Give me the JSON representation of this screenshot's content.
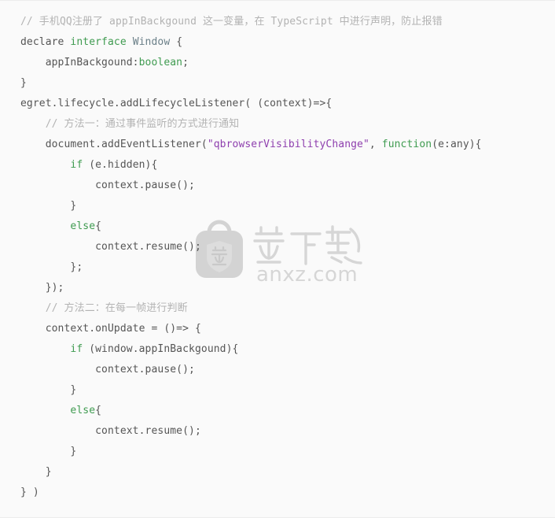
{
  "document": {
    "type": "code-snippet",
    "language": "TypeScript",
    "background_color": "#fafafa",
    "border_color": "#ececec",
    "colors": {
      "plain": "#555555",
      "comment": "#b3b3b3",
      "keyword": "#3f9b50",
      "type": "#6a7f88",
      "string": "#8e3fae",
      "watermark": "#d6d6d6"
    }
  },
  "code": {
    "lines": [
      {
        "index": 1,
        "text": "// 手机QQ注册了 appInBackgound 这一变量，在 TypeScript 中进行声明，防止报错",
        "tokens": [
          {
            "t": "// 手机QQ注册了 appInBackgound 这一变量，在 TypeScript 中进行声明，防止报错",
            "c": "comment"
          }
        ]
      },
      {
        "index": 2,
        "text": "declare interface Window {",
        "tokens": [
          {
            "t": "declare ",
            "c": "plain"
          },
          {
            "t": "interface",
            "c": "keyword"
          },
          {
            "t": " ",
            "c": "plain"
          },
          {
            "t": "Window",
            "c": "type"
          },
          {
            "t": " {",
            "c": "plain"
          }
        ]
      },
      {
        "index": 3,
        "text": "    appInBackgound:boolean;",
        "tokens": [
          {
            "t": "    appInBackgound:",
            "c": "plain"
          },
          {
            "t": "boolean",
            "c": "keyword"
          },
          {
            "t": ";",
            "c": "plain"
          }
        ]
      },
      {
        "index": 4,
        "text": "}",
        "tokens": [
          {
            "t": "}",
            "c": "plain"
          }
        ]
      },
      {
        "index": 5,
        "text": "egret.lifecycle.addLifecycleListener( (context)=>{",
        "tokens": [
          {
            "t": "egret.lifecycle.addLifecycleListener( (context)=>{",
            "c": "plain"
          }
        ]
      },
      {
        "index": 6,
        "text": "    // 方法一：通过事件监听的方式进行通知",
        "tokens": [
          {
            "t": "    ",
            "c": "plain"
          },
          {
            "t": "// 方法一：通过事件监听的方式进行通知",
            "c": "comment"
          }
        ]
      },
      {
        "index": 7,
        "text": "    document.addEventListener(\"qbrowserVisibilityChange\", function(e:any){",
        "tokens": [
          {
            "t": "    document.addEventListener(",
            "c": "plain"
          },
          {
            "t": "\"qbrowserVisibilityChange\"",
            "c": "string"
          },
          {
            "t": ", ",
            "c": "plain"
          },
          {
            "t": "function",
            "c": "keyword"
          },
          {
            "t": "(e:any){",
            "c": "plain"
          }
        ]
      },
      {
        "index": 8,
        "text": "        if (e.hidden){",
        "tokens": [
          {
            "t": "        ",
            "c": "plain"
          },
          {
            "t": "if",
            "c": "keyword"
          },
          {
            "t": " (e.hidden){",
            "c": "plain"
          }
        ]
      },
      {
        "index": 9,
        "text": "            context.pause();",
        "tokens": [
          {
            "t": "            context.pause();",
            "c": "plain"
          }
        ]
      },
      {
        "index": 10,
        "text": "        }",
        "tokens": [
          {
            "t": "        }",
            "c": "plain"
          }
        ]
      },
      {
        "index": 11,
        "text": "        else{",
        "tokens": [
          {
            "t": "        ",
            "c": "plain"
          },
          {
            "t": "else",
            "c": "keyword"
          },
          {
            "t": "{",
            "c": "plain"
          }
        ]
      },
      {
        "index": 12,
        "text": "            context.resume();",
        "tokens": [
          {
            "t": "            context.resume();",
            "c": "plain"
          }
        ]
      },
      {
        "index": 13,
        "text": "        };",
        "tokens": [
          {
            "t": "        };",
            "c": "plain"
          }
        ]
      },
      {
        "index": 14,
        "text": "    });",
        "tokens": [
          {
            "t": "    });",
            "c": "plain"
          }
        ]
      },
      {
        "index": 15,
        "text": "    // 方法二：在每一帧进行判断",
        "tokens": [
          {
            "t": "    ",
            "c": "plain"
          },
          {
            "t": "// 方法二：在每一帧进行判断",
            "c": "comment"
          }
        ]
      },
      {
        "index": 16,
        "text": "    context.onUpdate = ()=> {",
        "tokens": [
          {
            "t": "    context.onUpdate = ()=> {",
            "c": "plain"
          }
        ]
      },
      {
        "index": 17,
        "text": "        if (window.appInBackgound){",
        "tokens": [
          {
            "t": "        ",
            "c": "plain"
          },
          {
            "t": "if",
            "c": "keyword"
          },
          {
            "t": " (window.appInBackgound){",
            "c": "plain"
          }
        ]
      },
      {
        "index": 18,
        "text": "            context.pause();",
        "tokens": [
          {
            "t": "            context.pause();",
            "c": "plain"
          }
        ]
      },
      {
        "index": 19,
        "text": "        }",
        "tokens": [
          {
            "t": "        }",
            "c": "plain"
          }
        ]
      },
      {
        "index": 20,
        "text": "        else{",
        "tokens": [
          {
            "t": "        ",
            "c": "plain"
          },
          {
            "t": "else",
            "c": "keyword"
          },
          {
            "t": "{",
            "c": "plain"
          }
        ]
      },
      {
        "index": 21,
        "text": "            context.resume();",
        "tokens": [
          {
            "t": "            context.resume();",
            "c": "plain"
          }
        ]
      },
      {
        "index": 22,
        "text": "        }",
        "tokens": [
          {
            "t": "        }",
            "c": "plain"
          }
        ]
      },
      {
        "index": 23,
        "text": "    }",
        "tokens": [
          {
            "t": "    }",
            "c": "plain"
          }
        ]
      },
      {
        "index": 24,
        "text": "} )",
        "tokens": [
          {
            "t": "} )",
            "c": "plain"
          }
        ]
      }
    ]
  },
  "watermark": {
    "logo_glyph": "安",
    "brand_cn": "安下载",
    "brand_url": "anxz.com",
    "color": "#d6d6d6"
  }
}
